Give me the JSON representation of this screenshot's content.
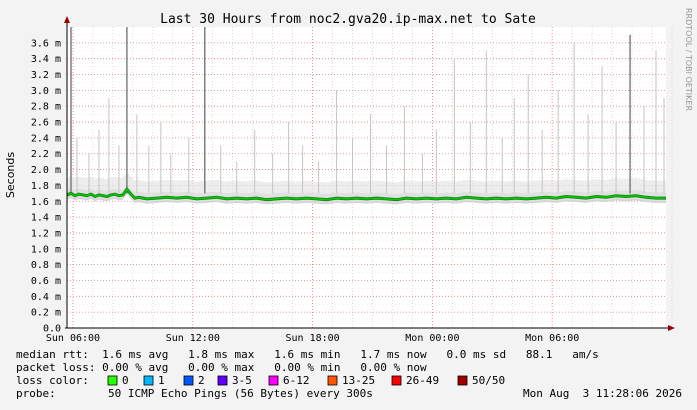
{
  "chart_data": {
    "type": "line",
    "title": "Last 30 Hours from noc2.gva20.ip-max.net to Sate",
    "ylabel": "Seconds",
    "side_label": "RRDTOOL / TOBI OETIKER",
    "y_unit_suffix": "m",
    "ylim": [
      0,
      3.8
    ],
    "y_ticks": [
      "0.0",
      "0.2",
      "0.4",
      "0.6",
      "0.8",
      "1.0",
      "1.2",
      "1.4",
      "1.6",
      "1.8",
      "2.0",
      "2.2",
      "2.4",
      "2.6",
      "2.8",
      "3.0",
      "3.2",
      "3.4",
      "3.6"
    ],
    "x_tick_labels": [
      "Sun 06:00",
      "Sun 12:00",
      "Sun 18:00",
      "Mon 00:00",
      "Mon 06:00"
    ],
    "x_tick_hours": [
      0.3,
      6.3,
      12.3,
      18.3,
      24.3
    ],
    "x_range_hours": [
      0,
      30
    ],
    "series": [
      {
        "name": "median rtt",
        "color": "#00cc00",
        "x_hours": [
          0.0,
          0.2,
          0.4,
          0.6,
          0.8,
          1.0,
          1.2,
          1.4,
          1.6,
          1.8,
          2.0,
          2.2,
          2.4,
          2.6,
          2.8,
          3.0,
          3.2,
          3.4,
          3.6,
          3.8,
          4.0,
          4.5,
          5.0,
          5.5,
          6.0,
          6.5,
          7.0,
          7.5,
          8.0,
          8.5,
          9.0,
          9.5,
          10.0,
          10.5,
          11.0,
          11.5,
          12.0,
          12.5,
          13.0,
          13.5,
          14.0,
          14.5,
          15.0,
          15.5,
          16.0,
          16.5,
          17.0,
          17.5,
          18.0,
          18.5,
          19.0,
          19.5,
          20.0,
          20.5,
          21.0,
          21.5,
          22.0,
          22.5,
          23.0,
          23.5,
          24.0,
          24.5,
          25.0,
          25.5,
          26.0,
          26.5,
          27.0,
          27.5,
          28.0,
          28.5,
          29.0,
          29.5,
          30.0
        ],
        "y_ms": [
          1.68,
          1.7,
          1.67,
          1.69,
          1.68,
          1.67,
          1.69,
          1.66,
          1.68,
          1.67,
          1.66,
          1.68,
          1.69,
          1.67,
          1.68,
          1.75,
          1.69,
          1.64,
          1.65,
          1.64,
          1.63,
          1.64,
          1.65,
          1.64,
          1.65,
          1.63,
          1.64,
          1.65,
          1.63,
          1.64,
          1.63,
          1.64,
          1.62,
          1.63,
          1.64,
          1.63,
          1.64,
          1.63,
          1.62,
          1.64,
          1.63,
          1.64,
          1.63,
          1.64,
          1.63,
          1.62,
          1.64,
          1.63,
          1.64,
          1.63,
          1.64,
          1.63,
          1.65,
          1.64,
          1.63,
          1.64,
          1.63,
          1.64,
          1.63,
          1.64,
          1.65,
          1.64,
          1.66,
          1.65,
          1.64,
          1.66,
          1.65,
          1.67,
          1.66,
          1.67,
          1.65,
          1.64,
          1.64
        ]
      }
    ],
    "smoke_spikes": [
      {
        "x_hours": 0.2,
        "y_ms": 3.8
      },
      {
        "x_hours": 0.5,
        "y_ms": 2.4
      },
      {
        "x_hours": 1.1,
        "y_ms": 2.2
      },
      {
        "x_hours": 1.6,
        "y_ms": 2.5
      },
      {
        "x_hours": 2.1,
        "y_ms": 2.9
      },
      {
        "x_hours": 2.6,
        "y_ms": 2.3
      },
      {
        "x_hours": 3.0,
        "y_ms": 3.8
      },
      {
        "x_hours": 3.5,
        "y_ms": 2.7
      },
      {
        "x_hours": 4.1,
        "y_ms": 2.3
      },
      {
        "x_hours": 4.7,
        "y_ms": 2.6
      },
      {
        "x_hours": 5.2,
        "y_ms": 2.2
      },
      {
        "x_hours": 6.1,
        "y_ms": 2.4
      },
      {
        "x_hours": 6.9,
        "y_ms": 3.8
      },
      {
        "x_hours": 7.7,
        "y_ms": 2.3
      },
      {
        "x_hours": 8.5,
        "y_ms": 2.1
      },
      {
        "x_hours": 9.4,
        "y_ms": 2.5
      },
      {
        "x_hours": 10.3,
        "y_ms": 2.2
      },
      {
        "x_hours": 11.1,
        "y_ms": 2.6
      },
      {
        "x_hours": 11.8,
        "y_ms": 2.3
      },
      {
        "x_hours": 12.6,
        "y_ms": 2.1
      },
      {
        "x_hours": 13.5,
        "y_ms": 3.0
      },
      {
        "x_hours": 14.3,
        "y_ms": 2.4
      },
      {
        "x_hours": 15.2,
        "y_ms": 2.7
      },
      {
        "x_hours": 16.0,
        "y_ms": 2.3
      },
      {
        "x_hours": 16.9,
        "y_ms": 2.8
      },
      {
        "x_hours": 17.8,
        "y_ms": 2.2
      },
      {
        "x_hours": 18.5,
        "y_ms": 2.5
      },
      {
        "x_hours": 19.4,
        "y_ms": 3.4
      },
      {
        "x_hours": 20.2,
        "y_ms": 2.6
      },
      {
        "x_hours": 21.0,
        "y_ms": 3.5
      },
      {
        "x_hours": 21.8,
        "y_ms": 2.4
      },
      {
        "x_hours": 22.4,
        "y_ms": 2.9
      },
      {
        "x_hours": 23.1,
        "y_ms": 3.2
      },
      {
        "x_hours": 23.8,
        "y_ms": 2.5
      },
      {
        "x_hours": 24.6,
        "y_ms": 3.0
      },
      {
        "x_hours": 25.4,
        "y_ms": 3.6
      },
      {
        "x_hours": 26.1,
        "y_ms": 2.7
      },
      {
        "x_hours": 26.8,
        "y_ms": 3.3
      },
      {
        "x_hours": 27.5,
        "y_ms": 2.6
      },
      {
        "x_hours": 28.2,
        "y_ms": 3.7
      },
      {
        "x_hours": 28.9,
        "y_ms": 2.8
      },
      {
        "x_hours": 29.5,
        "y_ms": 3.5
      },
      {
        "x_hours": 29.9,
        "y_ms": 2.9
      }
    ],
    "grid": true,
    "legend_placement": "bottom"
  },
  "stats": [
    "median rtt:  1.6 ms avg   1.8 ms max   1.6 ms min   1.7 ms now   0.0 ms sd   88.1   am/s",
    "packet loss: 0.00 % avg   0.00 % max   0.00 % min   0.00 % now"
  ],
  "loss_legend": {
    "label": "loss color:",
    "items": [
      {
        "label": "0",
        "color": "#26ff00"
      },
      {
        "label": "1",
        "color": "#00b8ff"
      },
      {
        "label": "2",
        "color": "#0059ff"
      },
      {
        "label": "3-5",
        "color": "#5e00ff"
      },
      {
        "label": "6-12",
        "color": "#ff00ff"
      },
      {
        "label": "13-25",
        "color": "#ff5500"
      },
      {
        "label": "26-49",
        "color": "#ff0000"
      },
      {
        "label": "50/50",
        "color": "#a10000"
      }
    ]
  },
  "probe": {
    "label": "probe:",
    "text": "50 ICMP Echo Pings (56 Bytes) every 300s",
    "timestamp": "Mon Aug  3 11:28:06 2026"
  }
}
